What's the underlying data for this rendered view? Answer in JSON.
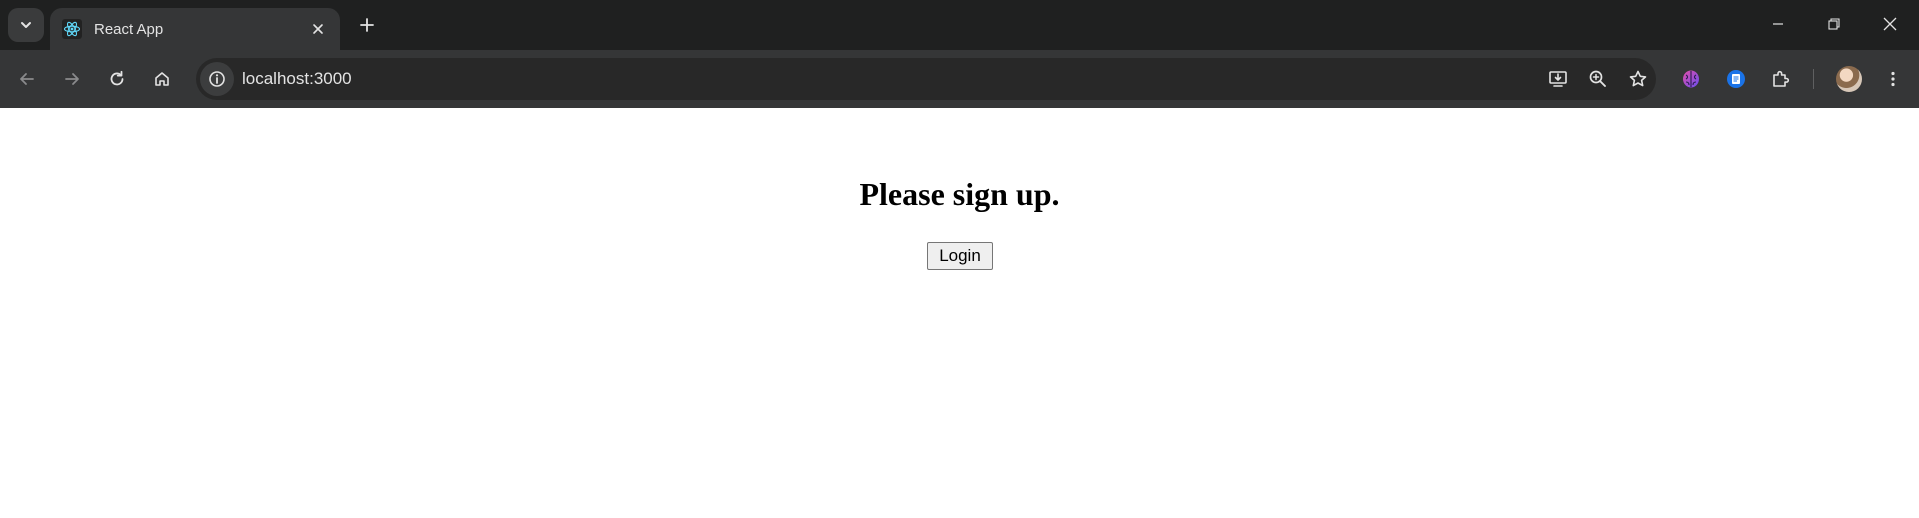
{
  "browser": {
    "tab": {
      "title": "React App",
      "favicon": "react-logo-icon"
    },
    "address_bar": {
      "url": "localhost:3000"
    },
    "icons": {
      "tab_search": "chevron-down-icon",
      "tab_close": "close-icon",
      "new_tab": "plus-icon",
      "back": "arrow-left-icon",
      "forward": "arrow-right-icon",
      "reload": "reload-icon",
      "home": "home-icon",
      "site_info": "info-icon",
      "install": "install-app-icon",
      "zoom": "zoom-in-icon",
      "bookmark": "star-icon",
      "extension_1": "brain-extension-icon",
      "extension_2": "docs-extension-icon",
      "extensions": "puzzle-icon",
      "profile": "avatar",
      "menu": "kebab-menu-icon",
      "minimize": "minimize-icon",
      "restore": "restore-icon",
      "close_window": "close-window-icon"
    },
    "colors": {
      "titlebar": "#1f2020",
      "toolbar": "#353637",
      "omnibox": "#282828",
      "accent": "#61dafb"
    }
  },
  "page": {
    "heading": "Please sign up.",
    "login_button": "Login"
  }
}
